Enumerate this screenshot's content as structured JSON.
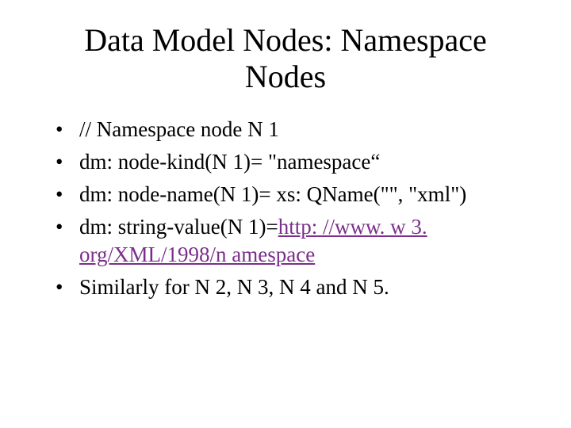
{
  "title": "Data Model Nodes: Namespace Nodes",
  "bullets": {
    "b1": "// Namespace node N 1",
    "b2": "dm: node-kind(N 1)= \"namespace“",
    "b3": "dm: node-name(N 1)= xs: QName(\"\", \"xml\")",
    "b4_prefix": "dm: string-value(N 1)=",
    "b4_link": "http: //www. w 3. org/XML/1998/n amespace",
    "b5": "Similarly for N 2, N 3, N 4 and N 5."
  }
}
